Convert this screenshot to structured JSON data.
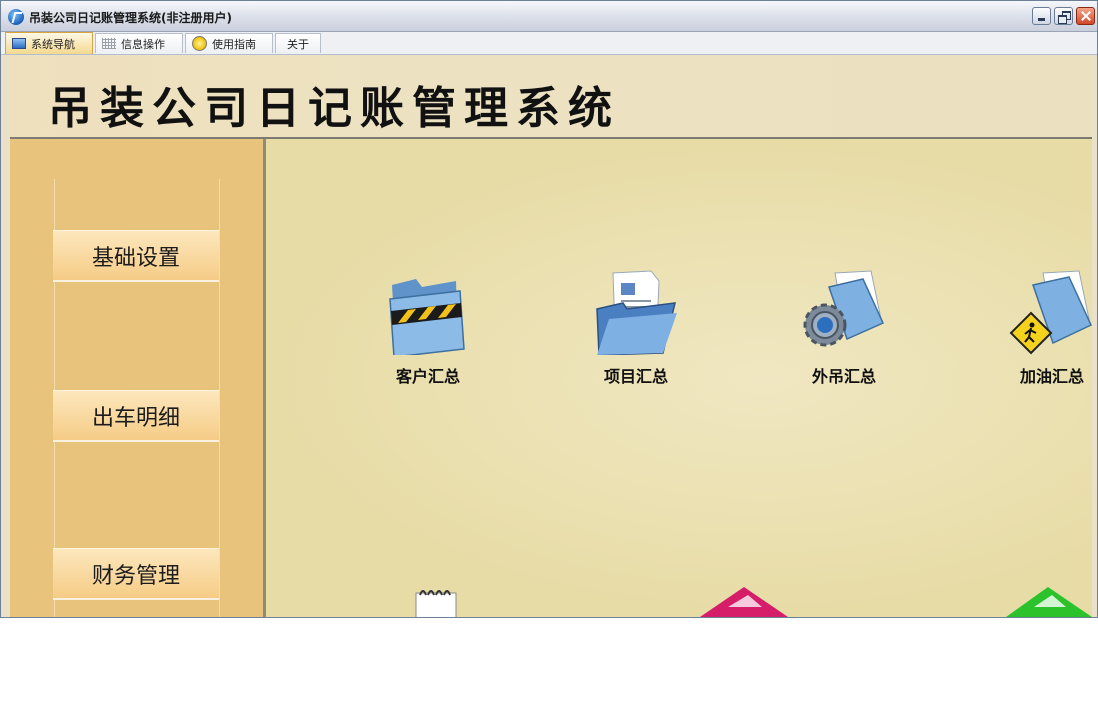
{
  "window": {
    "title": "吊装公司日记账管理系统(非注册用户)"
  },
  "tabs": [
    {
      "label": "系统导航",
      "icon": "nav-icon"
    },
    {
      "label": "信息操作",
      "icon": "grid-icon"
    },
    {
      "label": "使用指南",
      "icon": "guide-icon"
    },
    {
      "label": "关于"
    }
  ],
  "header": {
    "title": "吊装公司日记账管理系统"
  },
  "sidebar": {
    "items": [
      {
        "label": "基础设置"
      },
      {
        "label": "出车明细"
      },
      {
        "label": "财务管理"
      }
    ]
  },
  "main": {
    "icons": [
      {
        "label": "客户汇总",
        "icon": "striped-folder-icon"
      },
      {
        "label": "项目汇总",
        "icon": "document-folder-icon"
      },
      {
        "label": "外吊汇总",
        "icon": "gear-folder-icon"
      },
      {
        "label": "加油汇总",
        "icon": "warning-sign-folder-icon"
      }
    ]
  },
  "colors": {
    "sidebar": "#e8c37b",
    "content": "#eadfad",
    "header": "#ece2c2",
    "tab_active": "#f3d98f"
  }
}
